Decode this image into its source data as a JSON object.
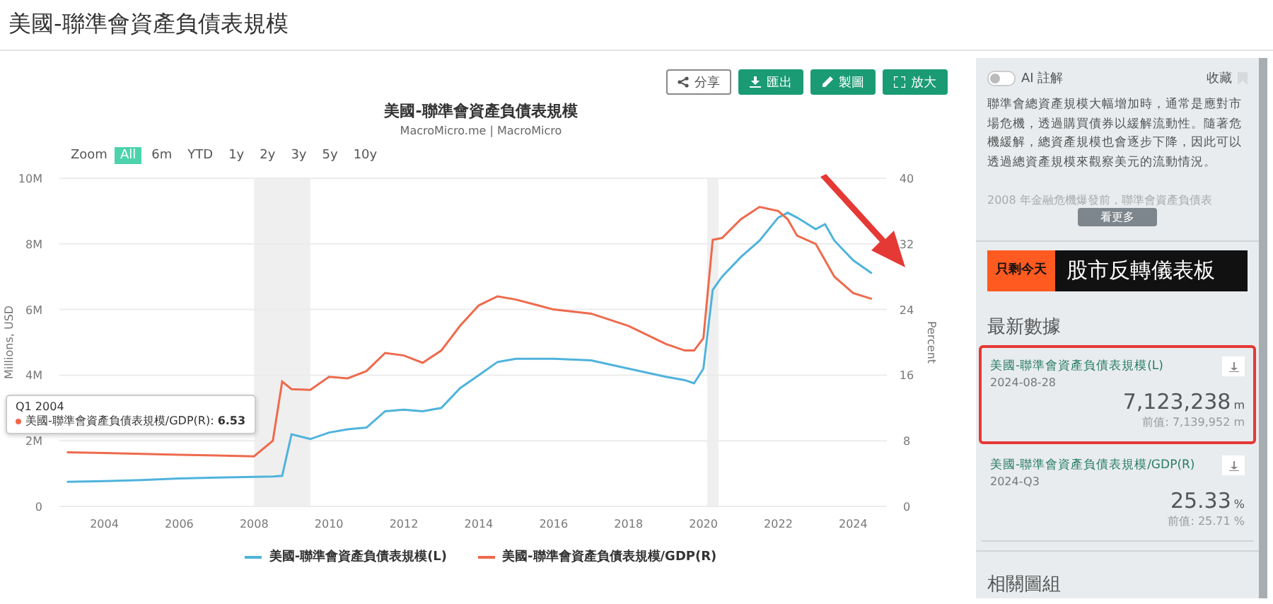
{
  "page_title": "美國-聯準會資產負債表規模",
  "toolbar": [
    {
      "label": "分享",
      "kind": "outline"
    },
    {
      "label": "匯出",
      "kind": "solid"
    },
    {
      "label": "製圖",
      "kind": "solid"
    },
    {
      "label": "放大",
      "kind": "solid"
    }
  ],
  "chart": {
    "title": "美國-聯準會資產負債表規模",
    "subtitle": "MacroMicro.me | MacroMicro",
    "zoom_label": "Zoom",
    "zoom_options": [
      {
        "label": "All",
        "selected": true
      },
      {
        "label": "6m",
        "selected": false
      },
      {
        "label": "YTD",
        "selected": false
      },
      {
        "label": "1y",
        "selected": false
      },
      {
        "label": "2y",
        "selected": false
      },
      {
        "label": "3y",
        "selected": false
      },
      {
        "label": "5y",
        "selected": false
      },
      {
        "label": "10y",
        "selected": false
      }
    ],
    "tooltip": {
      "title": "Q1 2004",
      "series": "美國-聯準會資產負債表規模/GDP(R):",
      "value": "6.53",
      "color": "#ee6a4d"
    },
    "chart_data": {
      "type": "line",
      "ylabel": "Millions, USD",
      "xlim": [
        2002.8,
        2024.9
      ],
      "ylim": [
        0,
        10
      ],
      "y2label": "Percent",
      "y2lim": [
        0,
        40
      ],
      "y2ticks": [
        0,
        8,
        16,
        24,
        32,
        40
      ],
      "xticks": [
        2004,
        2006,
        2008,
        2010,
        2012,
        2014,
        2016,
        2018,
        2020,
        2022,
        2024
      ],
      "yticks": [
        {
          "value": 0,
          "label": "0"
        },
        {
          "value": 2,
          "label": "2M"
        },
        {
          "value": 4,
          "label": "4M"
        },
        {
          "value": 6,
          "label": "6M"
        },
        {
          "value": 8,
          "label": "8M"
        },
        {
          "value": 10,
          "label": "10M"
        }
      ],
      "x": [
        2003,
        2004,
        2005,
        2006,
        2007,
        2008,
        2008.5,
        2008.75,
        2009,
        2009.5,
        2010,
        2010.5,
        2011,
        2011.5,
        2012,
        2012.5,
        2013,
        2013.5,
        2014,
        2014.5,
        2015,
        2016,
        2017,
        2018,
        2019,
        2019.5,
        2019.75,
        2020,
        2020.25,
        2020.5,
        2021,
        2021.5,
        2022,
        2022.25,
        2022.5,
        2023,
        2023.25,
        2023.5,
        2024,
        2024.5
      ],
      "series": [
        {
          "name": "美國-聯準會資產負債表規模(L)",
          "color": "#4fb3dc",
          "values": [
            0.75,
            0.77,
            0.8,
            0.85,
            0.88,
            0.9,
            0.91,
            0.93,
            2.2,
            2.05,
            2.25,
            2.35,
            2.4,
            2.9,
            2.95,
            2.9,
            3.0,
            3.6,
            4.0,
            4.4,
            4.5,
            4.5,
            4.45,
            4.2,
            3.95,
            3.85,
            3.75,
            4.2,
            6.6,
            7.0,
            7.6,
            8.1,
            8.8,
            8.95,
            8.8,
            8.45,
            8.6,
            8.1,
            7.5,
            7.1
          ]
        },
        {
          "name": "美國-聯準會資產負債表規模/GDP(R)",
          "color": "#ee6a4d",
          "axis": "y2",
          "values": [
            6.6,
            6.5,
            6.4,
            6.3,
            6.2,
            6.1,
            8.0,
            15.2,
            14.3,
            14.2,
            15.8,
            15.6,
            16.5,
            18.7,
            18.4,
            17.5,
            19,
            22,
            24.5,
            25.6,
            25.2,
            24,
            23.5,
            22,
            19.8,
            19,
            19,
            20.5,
            32.5,
            32.7,
            35,
            36.5,
            36,
            35,
            33,
            32,
            30,
            28,
            26,
            25.3
          ]
        }
      ],
      "grid": true,
      "bands": [
        {
          "axis": "x",
          "from": 2008,
          "to": 2009.5
        },
        {
          "axis": "x",
          "from": 2020.1,
          "to": 2020.4
        }
      ]
    }
  },
  "sidebar": {
    "ai_toggle": {
      "label": "AI 註解",
      "on": false
    },
    "favorite": "收藏",
    "description": "聯準會總資產規模大幅增加時，通常是應對市場危機，透過購買債券以緩解流動性。隨著危機緩解，總資產規模也會逐步下降，因此可以透過總資產規模來觀察美元的流動情況。",
    "description_more": "2008 年金融危機爆發前，聯準會資產負債表",
    "more_button": "看更多",
    "banner": {
      "tag": "只剩今天",
      "headline": "股市反轉儀表板"
    },
    "latest_title": "最新數據",
    "latest": [
      {
        "name": "美國-聯準會資產負債表規模(L)",
        "date": "2024-08-28",
        "value": "7,123,238",
        "unit": "m",
        "previous": "前值: 7,139,952 m",
        "highlighted": true
      },
      {
        "name": "美國-聯準會資產負債表規模/GDP(R)",
        "date": "2024-Q3",
        "value": "25.33",
        "unit": "%",
        "previous": "前值: 25.71 %",
        "highlighted": false
      }
    ],
    "related_title": "相關圖組"
  }
}
